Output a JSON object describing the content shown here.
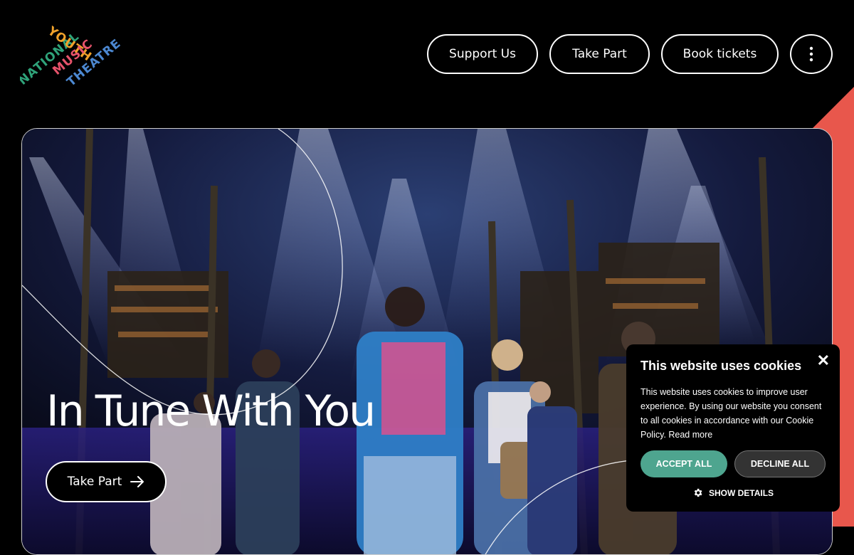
{
  "logo": {
    "line1": "NATIONAL",
    "line2": "YOUTH",
    "line3": "MUSIC",
    "line4": "THEATRE",
    "colors": [
      "#2fa37a",
      "#f0a22b",
      "#e7536b",
      "#4c88d1"
    ]
  },
  "nav": {
    "support_label": "Support Us",
    "takepart_label": "Take Part",
    "tickets_label": "Book tickets",
    "more_icon": "kebab-menu-icon"
  },
  "hero": {
    "title": "In Tune With You",
    "cta_label": "Take Part",
    "cta_icon": "arrow-right-icon"
  },
  "cookie": {
    "title": "This website uses cookies",
    "body": "This website uses cookies to improve user experience. By using our website you consent to all cookies in accordance with our Cookie Policy. Read more",
    "accept_label": "ACCEPT ALL",
    "decline_label": "DECLINE ALL",
    "details_label": "SHOW DETAILS",
    "accent": "#4ea58f"
  },
  "colors": {
    "corner": "#e8574c"
  }
}
